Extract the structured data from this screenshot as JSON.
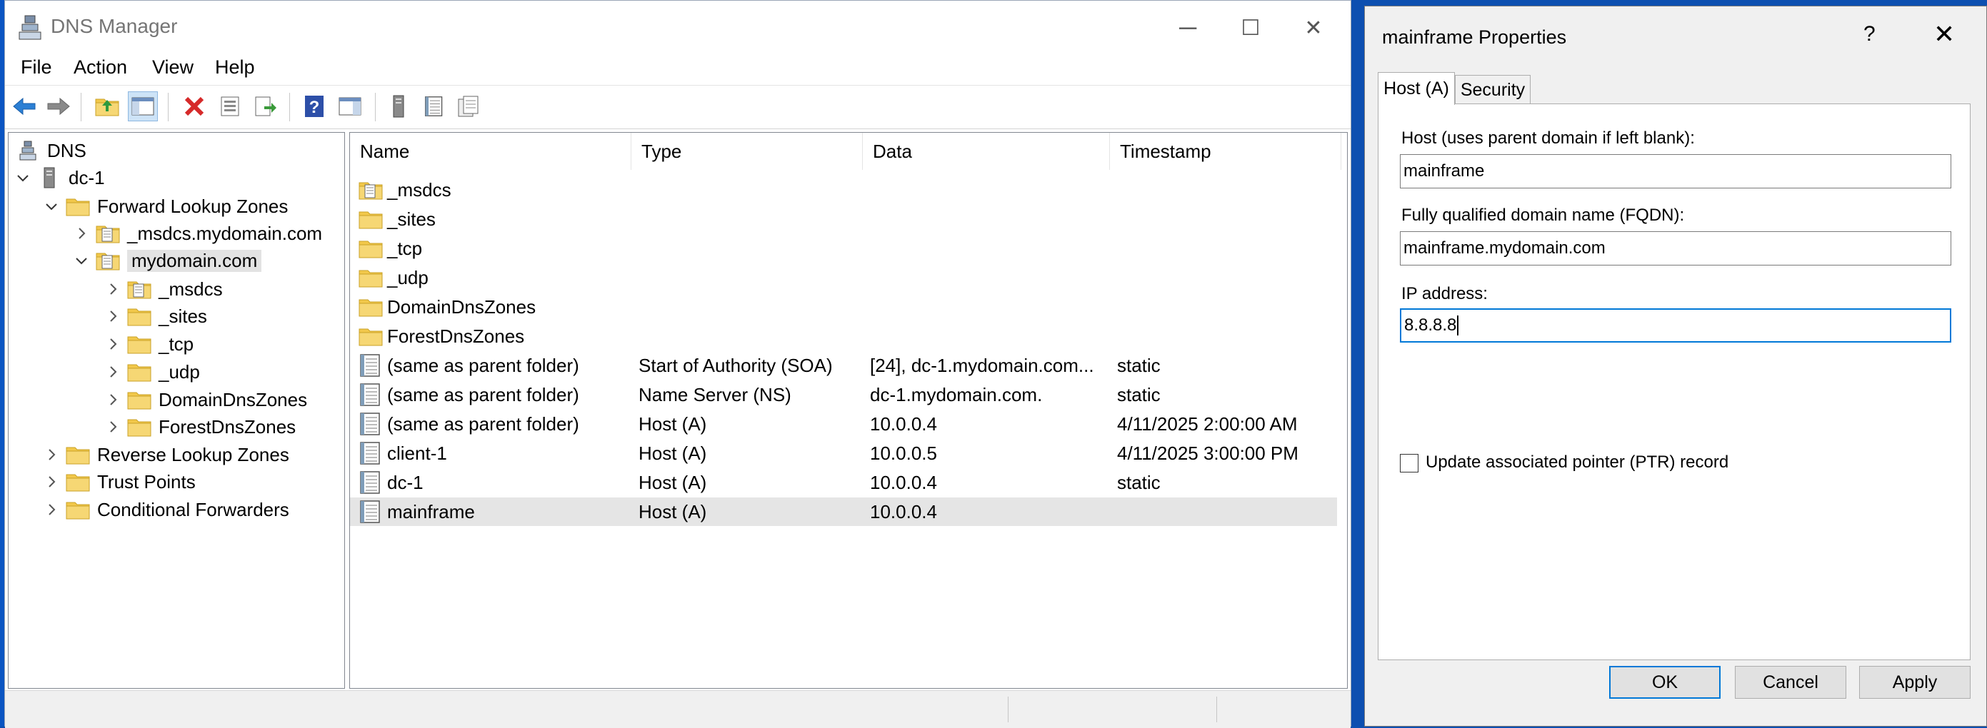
{
  "app": {
    "title": "DNS Manager",
    "window_controls": {
      "minimize": "─",
      "maximize": "☐",
      "close": "✕"
    }
  },
  "menu": [
    "File",
    "Action",
    "View",
    "Help"
  ],
  "toolbar": {
    "buttons": [
      "back-icon",
      "forward-icon",
      "up-folder-icon",
      "show-tree-icon",
      "delete-icon",
      "properties-icon",
      "export-icon",
      "help-icon",
      "show-pane-icon",
      "server-icon",
      "list-icon",
      "report-icon"
    ]
  },
  "tree": {
    "root": "DNS",
    "server": "dc-1",
    "forward_zones": "Forward Lookup Zones",
    "msdcs_zone": "_msdcs.mydomain.com",
    "zone": "mydomain.com",
    "zone_children": [
      "_msdcs",
      "_sites",
      "_tcp",
      "_udp",
      "DomainDnsZones",
      "ForestDnsZones"
    ],
    "reverse_zones": "Reverse Lookup Zones",
    "trust_points": "Trust Points",
    "conditional_forwarders": "Conditional Forwarders"
  },
  "list": {
    "columns": [
      "Name",
      "Type",
      "Data",
      "Timestamp"
    ],
    "rows": [
      {
        "icon": "zone-icon",
        "name": "_msdcs",
        "type": "",
        "data": "",
        "timestamp": ""
      },
      {
        "icon": "folder-icon",
        "name": "_sites",
        "type": "",
        "data": "",
        "timestamp": ""
      },
      {
        "icon": "folder-icon",
        "name": "_tcp",
        "type": "",
        "data": "",
        "timestamp": ""
      },
      {
        "icon": "folder-icon",
        "name": "_udp",
        "type": "",
        "data": "",
        "timestamp": ""
      },
      {
        "icon": "folder-icon",
        "name": "DomainDnsZones",
        "type": "",
        "data": "",
        "timestamp": ""
      },
      {
        "icon": "folder-icon",
        "name": "ForestDnsZones",
        "type": "",
        "data": "",
        "timestamp": ""
      },
      {
        "icon": "record-icon",
        "name": "(same as parent folder)",
        "type": "Start of Authority (SOA)",
        "data": "[24], dc-1.mydomain.com...",
        "timestamp": "static"
      },
      {
        "icon": "record-icon",
        "name": "(same as parent folder)",
        "type": "Name Server (NS)",
        "data": "dc-1.mydomain.com.",
        "timestamp": "static"
      },
      {
        "icon": "record-icon",
        "name": "(same as parent folder)",
        "type": "Host (A)",
        "data": "10.0.0.4",
        "timestamp": "4/11/2025 2:00:00 AM"
      },
      {
        "icon": "record-icon",
        "name": "client-1",
        "type": "Host (A)",
        "data": "10.0.0.5",
        "timestamp": "4/11/2025 3:00:00 PM"
      },
      {
        "icon": "record-icon",
        "name": "dc-1",
        "type": "Host (A)",
        "data": "10.0.0.4",
        "timestamp": "static"
      },
      {
        "icon": "record-icon",
        "name": "mainframe",
        "type": "Host (A)",
        "data": "10.0.0.4",
        "timestamp": ""
      }
    ]
  },
  "dialog": {
    "title": "mainframe Properties",
    "help": "?",
    "close": "✕",
    "tabs": [
      "Host (A)",
      "Security"
    ],
    "host_label": "Host (uses parent domain if left blank):",
    "host_value": "mainframe",
    "fqdn_label": "Fully qualified domain name (FQDN):",
    "fqdn_value": "mainframe.mydomain.com",
    "ip_label": "IP address:",
    "ip_value": "8.8.8.8",
    "ptr_label": "Update associated pointer (PTR) record",
    "ptr_checked": false,
    "buttons": {
      "ok": "OK",
      "cancel": "Cancel",
      "apply": "Apply"
    }
  }
}
